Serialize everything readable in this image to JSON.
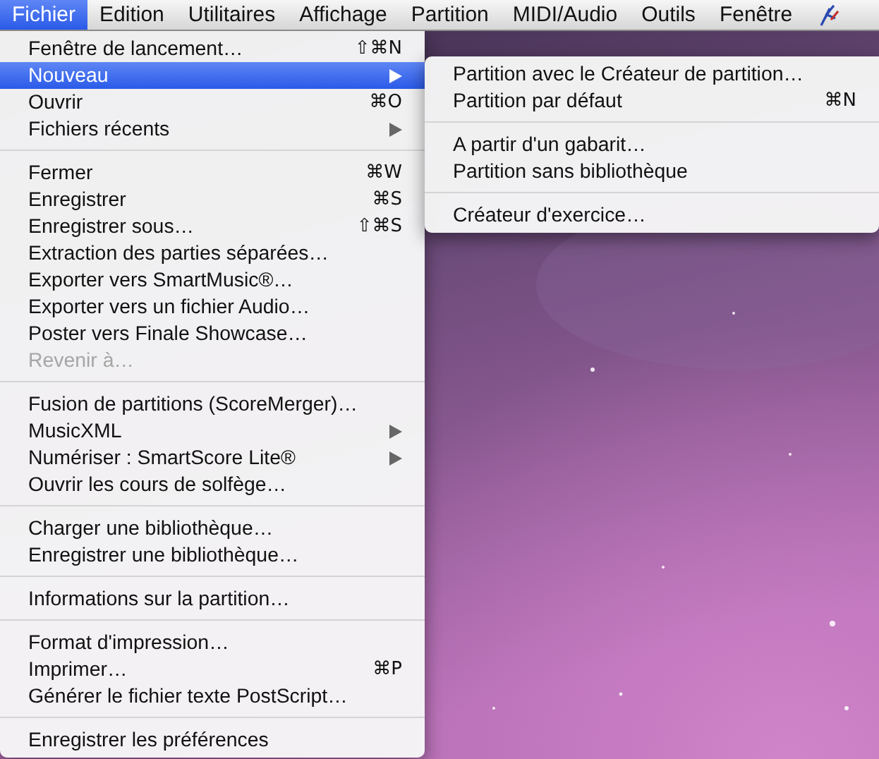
{
  "menu_bar": {
    "items": [
      {
        "label": "Fichier",
        "selected": true
      },
      {
        "label": "Edition",
        "selected": false
      },
      {
        "label": "Utilitaires",
        "selected": false
      },
      {
        "label": "Affichage",
        "selected": false
      },
      {
        "label": "Partition",
        "selected": false
      },
      {
        "label": "MIDI/Audio",
        "selected": false
      },
      {
        "label": "Outils",
        "selected": false
      },
      {
        "label": "Fenêtre",
        "selected": false
      }
    ]
  },
  "file_menu": {
    "items": [
      {
        "kind": "item",
        "label": "Fenêtre de lancement…",
        "shortcut": "⇧⌘N",
        "submenu": false,
        "disabled": false,
        "selected": false
      },
      {
        "kind": "item",
        "label": "Nouveau",
        "submenu": true,
        "disabled": false,
        "selected": true
      },
      {
        "kind": "item",
        "label": "Ouvrir",
        "shortcut": "⌘O",
        "submenu": false,
        "disabled": false,
        "selected": false
      },
      {
        "kind": "item",
        "label": "Fichiers récents",
        "submenu": true,
        "disabled": false,
        "selected": false
      },
      {
        "kind": "separator"
      },
      {
        "kind": "item",
        "label": "Fermer",
        "shortcut": "⌘W",
        "submenu": false,
        "disabled": false,
        "selected": false
      },
      {
        "kind": "item",
        "label": "Enregistrer",
        "shortcut": "⌘S",
        "submenu": false,
        "disabled": false,
        "selected": false
      },
      {
        "kind": "item",
        "label": "Enregistrer sous…",
        "shortcut": "⇧⌘S",
        "submenu": false,
        "disabled": false,
        "selected": false
      },
      {
        "kind": "item",
        "label": "Extraction des parties séparées…",
        "submenu": false,
        "disabled": false,
        "selected": false
      },
      {
        "kind": "item",
        "label": "Exporter vers SmartMusic®…",
        "submenu": false,
        "disabled": false,
        "selected": false
      },
      {
        "kind": "item",
        "label": "Exporter vers un fichier Audio…",
        "submenu": false,
        "disabled": false,
        "selected": false
      },
      {
        "kind": "item",
        "label": "Poster vers Finale Showcase…",
        "submenu": false,
        "disabled": false,
        "selected": false
      },
      {
        "kind": "item",
        "label": "Revenir à…",
        "submenu": false,
        "disabled": true,
        "selected": false
      },
      {
        "kind": "separator"
      },
      {
        "kind": "item",
        "label": "Fusion de partitions (ScoreMerger)…",
        "submenu": false,
        "disabled": false,
        "selected": false
      },
      {
        "kind": "item",
        "label": "MusicXML",
        "submenu": true,
        "disabled": false,
        "selected": false
      },
      {
        "kind": "item",
        "label": "Numériser : SmartScore Lite®",
        "submenu": true,
        "disabled": false,
        "selected": false
      },
      {
        "kind": "item",
        "label": "Ouvrir les cours de solfège…",
        "submenu": false,
        "disabled": false,
        "selected": false
      },
      {
        "kind": "separator"
      },
      {
        "kind": "item",
        "label": "Charger une bibliothèque…",
        "submenu": false,
        "disabled": false,
        "selected": false
      },
      {
        "kind": "item",
        "label": "Enregistrer une bibliothèque…",
        "submenu": false,
        "disabled": false,
        "selected": false
      },
      {
        "kind": "separator"
      },
      {
        "kind": "item",
        "label": "Informations sur la partition…",
        "submenu": false,
        "disabled": false,
        "selected": false
      },
      {
        "kind": "separator"
      },
      {
        "kind": "item",
        "label": "Format d'impression…",
        "submenu": false,
        "disabled": false,
        "selected": false
      },
      {
        "kind": "item",
        "label": "Imprimer…",
        "shortcut": "⌘P",
        "submenu": false,
        "disabled": false,
        "selected": false
      },
      {
        "kind": "item",
        "label": "Générer le fichier texte PostScript…",
        "submenu": false,
        "disabled": false,
        "selected": false
      },
      {
        "kind": "separator"
      },
      {
        "kind": "item",
        "label": "Enregistrer les préférences",
        "submenu": false,
        "disabled": false,
        "selected": false
      }
    ]
  },
  "new_submenu": {
    "items": [
      {
        "kind": "item",
        "label": "Partition avec le Créateur de partition…",
        "submenu": false,
        "disabled": false,
        "selected": false
      },
      {
        "kind": "item",
        "label": "Partition par défaut",
        "shortcut": "⌘N",
        "submenu": false,
        "disabled": false,
        "selected": false
      },
      {
        "kind": "separator"
      },
      {
        "kind": "item",
        "label": "A partir d'un gabarit…",
        "submenu": false,
        "disabled": false,
        "selected": false
      },
      {
        "kind": "item",
        "label": "Partition sans bibliothèque",
        "submenu": false,
        "disabled": false,
        "selected": false
      },
      {
        "kind": "separator"
      },
      {
        "kind": "item",
        "label": "Créateur d'exercice…",
        "submenu": false,
        "disabled": false,
        "selected": false
      }
    ]
  }
}
